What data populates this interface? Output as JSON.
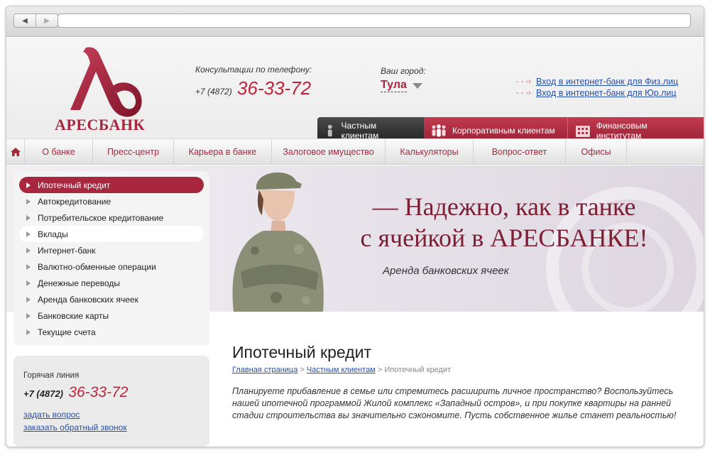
{
  "header": {
    "logo_text": "АРЕСБАНК",
    "consult_label": "Консультации по телефону:",
    "phone_code": "+7 (4872)",
    "phone_number": "36-33-72",
    "city_label": "Ваш город:",
    "city_value": "Тула",
    "ebank_links": [
      "Вход в интернет-банк для Физ.лиц",
      "Вход в интернет-банк для Юр.лиц"
    ],
    "segments": [
      "Частным клиентам",
      "Корпоративным клиентам",
      "Финансовым институтам"
    ]
  },
  "nav": {
    "items": [
      "О банке",
      "Пресс-центр",
      "Карьера в банке",
      "Залоговое имущество",
      "Калькуляторы",
      "Вопрос-ответ",
      "Офисы"
    ]
  },
  "banner": {
    "slogan_line1": "— Надежно, как в танке",
    "slogan_line2": "с ячейкой в АРЕСБАНКЕ!",
    "subtitle": "Аренда банковских ячеек"
  },
  "sidemenu": {
    "items": [
      "Ипотечный кредит",
      "Автокредитование",
      "Потребительское кредитование",
      "Вклады",
      "Интернет-банк",
      "Валютно-обменные операции",
      "Денежные переводы",
      "Аренда банковских ячеек",
      "Банковские карты",
      "Текущие счета"
    ]
  },
  "hotline": {
    "title": "Горячая линия",
    "phone_code": "+7 (4872)",
    "phone_number": "36-33-72",
    "ask_link": "задать вопрос",
    "callback_link": "заказать обратный звонок"
  },
  "content": {
    "title": "Ипотечный кредит",
    "crumb_home": "Главная страница",
    "crumb_sep": " > ",
    "crumb_section": "Частным клиентам",
    "crumb_current": "Ипотечный кредит",
    "intro": "Планируете прибавление в семье или стремитесь расширить личное пространство? Воспользуйтесь нашей ипотечной программой Жилой комплекс «Западный остров», и при покупке квартиры на ранней стадии строительства вы значительно сэкономите. Пусть собственное жилье станет реальностью!"
  },
  "colors": {
    "brand": "#a8273e",
    "accent_red": "#c0243a",
    "link": "#2750a8"
  }
}
